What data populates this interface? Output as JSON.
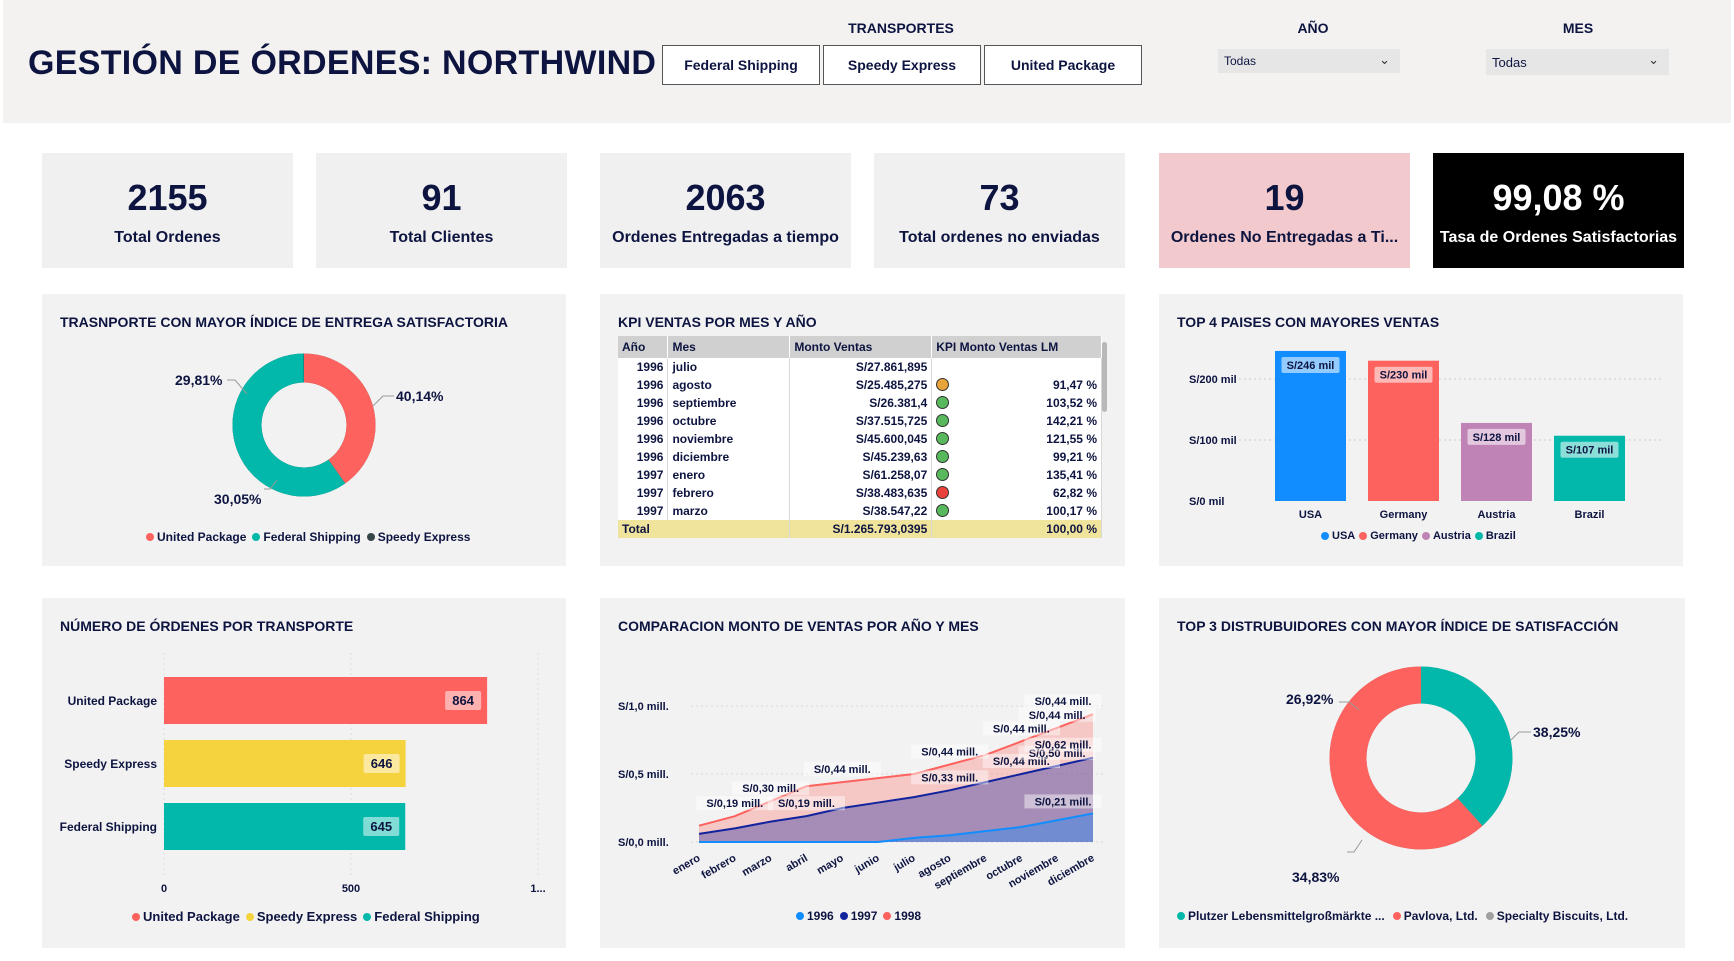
{
  "header": {
    "title": "GESTIÓN DE ÓRDENES: NORTHWIND",
    "transport_label": "TRANSPORTES",
    "transport_buttons": [
      "Federal Shipping",
      "Speedy Express",
      "United Package"
    ],
    "year_label": "AÑO",
    "year_value": "Todas",
    "month_label": "MES",
    "month_value": "Todas"
  },
  "cards": [
    {
      "value": "2155",
      "label": "Total Ordenes"
    },
    {
      "value": "91",
      "label": "Total Clientes"
    },
    {
      "value": "2063",
      "label": "Ordenes Entregadas a tiempo"
    },
    {
      "value": "73",
      "label": "Total ordenes no enviadas"
    },
    {
      "value": "19",
      "label": "Ordenes No Entregadas a Ti..."
    },
    {
      "value": "99,08 %",
      "label": "Tasa de Ordenes Satisfactorias"
    }
  ],
  "colors": {
    "red": "#fd625e",
    "teal": "#01b8aa",
    "dark": "#374649",
    "yellow": "#f5d33f",
    "blue": "#118dff",
    "navy": "#12239e",
    "mauve": "#c083b5",
    "grey": "#a0a0a0"
  },
  "donut1": {
    "title": "TRASNPORTE CON MAYOR ÍNDICE DE ENTREGA SATISFACTORIA",
    "labels": [
      "40,14%",
      "30,05%",
      "29,81%"
    ],
    "legend": [
      "United Package",
      "Federal Shipping",
      "Speedy Express"
    ]
  },
  "kpi": {
    "title": "KPI VENTAS POR MES Y AÑO",
    "headers": [
      "Año",
      "Mes",
      "Monto Ventas",
      "KPI Monto Ventas LM"
    ],
    "rows": [
      {
        "year": "1996",
        "month": "julio",
        "amount": "S/27.861,895",
        "status": "",
        "kpi": ""
      },
      {
        "year": "1996",
        "month": "agosto",
        "amount": "S/25.485,275",
        "status": "warning",
        "kpi": "91,47 %"
      },
      {
        "year": "1996",
        "month": "septiembre",
        "amount": "S/26.381,4",
        "status": "good",
        "kpi": "103,52 %"
      },
      {
        "year": "1996",
        "month": "octubre",
        "amount": "S/37.515,725",
        "status": "good",
        "kpi": "142,21 %"
      },
      {
        "year": "1996",
        "month": "noviembre",
        "amount": "S/45.600,045",
        "status": "good",
        "kpi": "121,55 %"
      },
      {
        "year": "1996",
        "month": "diciembre",
        "amount": "S/45.239,63",
        "status": "good",
        "kpi": "99,21 %"
      },
      {
        "year": "1997",
        "month": "enero",
        "amount": "S/61.258,07",
        "status": "good",
        "kpi": "135,41 %"
      },
      {
        "year": "1997",
        "month": "febrero",
        "amount": "S/38.483,635",
        "status": "bad",
        "kpi": "62,82 %"
      },
      {
        "year": "1997",
        "month": "marzo",
        "amount": "S/38.547,22",
        "status": "good",
        "kpi": "100,17 %"
      }
    ],
    "total": {
      "label": "Total",
      "amount": "S/1.265.793,0395",
      "kpi": "100,00 %"
    }
  },
  "top4": {
    "title": "TOP 4 PAISES CON MAYORES VENTAS",
    "yticks": [
      "S/200 mil",
      "S/100 mil",
      "S/0 mil"
    ],
    "legend": [
      "USA",
      "Germany",
      "Austria",
      "Brazil"
    ]
  },
  "bars": {
    "title": "NÚMERO DE ÓRDENES POR TRANSPORTE",
    "xticks": [
      "0",
      "500",
      "1..."
    ],
    "legend": [
      "United Package",
      "Speedy Express",
      "Federal Shipping"
    ]
  },
  "area": {
    "title": "COMPARACION MONTO DE VENTAS POR AÑO Y MES",
    "yticks": [
      "S/1,0 mill.",
      "S/0,5 mill.",
      "S/0,0 mill."
    ],
    "legend": [
      "1996",
      "1997",
      "1998"
    ]
  },
  "donut2": {
    "title": "TOP 3 DISTRUBUIDORES CON MAYOR ÍNDICE DE SATISFACCIÓN",
    "labels": [
      "38,25%",
      "34,83%",
      "26,92%"
    ],
    "legend": [
      "Plutzer Lebensmittelgroßmärkte ...",
      "Pavlova, Ltd.",
      "Specialty Biscuits, Ltd."
    ]
  },
  "chart_data": [
    {
      "type": "pie",
      "title": "TRASNPORTE CON MAYOR ÍNDICE DE ENTREGA SATISFACTORIA",
      "categories": [
        "United Package",
        "Federal Shipping",
        "Speedy Express"
      ],
      "values": [
        40.14,
        30.05,
        29.81
      ]
    },
    {
      "type": "table",
      "title": "KPI VENTAS POR MES Y AÑO"
    },
    {
      "type": "bar",
      "title": "TOP 4 PAISES CON MAYORES VENTAS",
      "categories": [
        "USA",
        "Germany",
        "Austria",
        "Brazil"
      ],
      "values": [
        246,
        230,
        128,
        107
      ],
      "data_labels": [
        "S/246 mil",
        "S/230 mil",
        "S/128 mil",
        "S/107 mil"
      ],
      "ylim": [
        0,
        250
      ]
    },
    {
      "type": "bar",
      "title": "NÚMERO DE ÓRDENES POR TRANSPORTE",
      "categories": [
        "United Package",
        "Speedy Express",
        "Federal Shipping"
      ],
      "values": [
        864,
        646,
        645
      ],
      "xlim": [
        0,
        1000
      ]
    },
    {
      "type": "area",
      "title": "COMPARACION MONTO DE VENTAS POR AÑO Y MES",
      "categories": [
        "enero",
        "febrero",
        "marzo",
        "abril",
        "mayo",
        "junio",
        "julio",
        "agosto",
        "septiembre",
        "octubre",
        "noviembre",
        "diciembre"
      ],
      "series": [
        {
          "name": "1996",
          "values": [
            0,
            0,
            0,
            0,
            0,
            0,
            0.03,
            0.05,
            0.08,
            0.11,
            0.16,
            0.21
          ]
        },
        {
          "name": "1997",
          "values": [
            0.06,
            0.1,
            0.15,
            0.19,
            0.25,
            0.29,
            0.33,
            0.38,
            0.44,
            0.5,
            0.56,
            0.62
          ]
        },
        {
          "name": "1998",
          "values": [
            0.12,
            0.19,
            0.3,
            0.41,
            0.44,
            0.47,
            0.5,
            0.57,
            0.64,
            0.74,
            0.84,
            0.94
          ]
        }
      ],
      "data_labels": [
        {
          "series": "1998",
          "month": "febrero",
          "text": "S/0,19 mill."
        },
        {
          "series": "1998",
          "month": "marzo",
          "text": "S/0,30 mill."
        },
        {
          "series": "1998",
          "month": "mayo",
          "text": "S/0,44 mill."
        },
        {
          "series": "1998",
          "month": "agosto",
          "text": "S/0,44 mill."
        },
        {
          "series": "1998",
          "month": "octubre",
          "text": "S/0,44 mill."
        },
        {
          "series": "1998",
          "month": "noviembre",
          "text": "S/0,44 mill."
        },
        {
          "series": "1998",
          "month": "diciembre",
          "text": "S/0,44 mill."
        },
        {
          "series": "1997",
          "month": "abril",
          "text": "S/0,19 mill."
        },
        {
          "series": "1997",
          "month": "agosto",
          "text": "S/0,33 mill."
        },
        {
          "series": "1997",
          "month": "octubre",
          "text": "S/0,44 mill."
        },
        {
          "series": "1997",
          "month": "noviembre",
          "text": "S/0,50 mill."
        },
        {
          "series": "1997",
          "month": "diciembre",
          "text": "S/0,62 mill."
        },
        {
          "series": "1996",
          "month": "diciembre",
          "text": "S/0,21 mill."
        }
      ],
      "ylim": [
        0,
        1.2
      ]
    },
    {
      "type": "pie",
      "title": "TOP 3 DISTRUBUIDORES CON MAYOR ÍNDICE DE SATISFACCIÓN",
      "categories": [
        "Plutzer Lebensmittelgroßmärkte ...",
        "Pavlova, Ltd.",
        "Specialty Biscuits, Ltd."
      ],
      "values": [
        38.25,
        34.83,
        26.92
      ]
    }
  ]
}
